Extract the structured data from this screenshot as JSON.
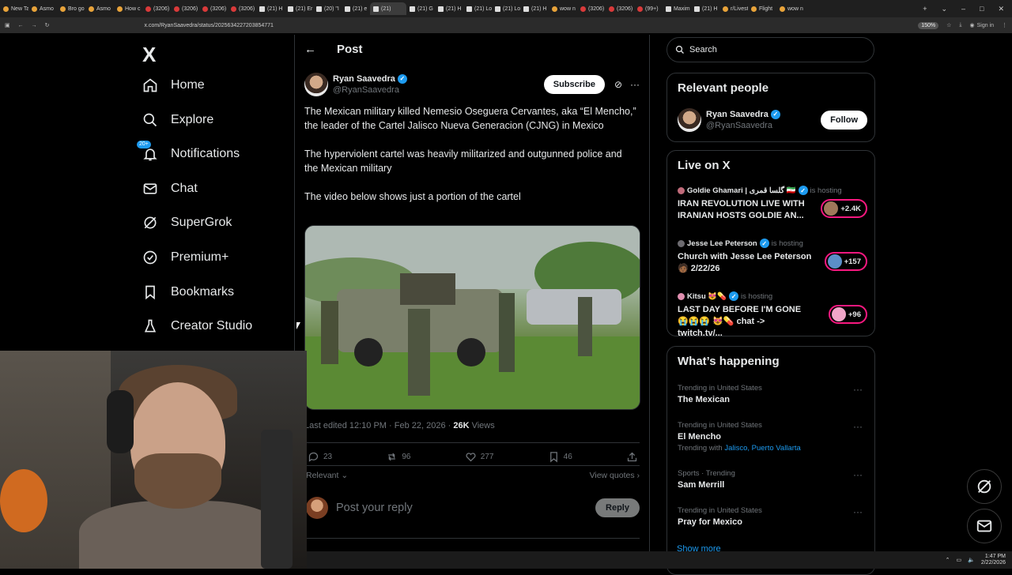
{
  "browser": {
    "tabs": [
      {
        "label": "New Ta",
        "icon": "o"
      },
      {
        "label": "Asmo",
        "icon": "o"
      },
      {
        "label": "Bro go",
        "icon": "o"
      },
      {
        "label": "Asmo",
        "icon": "o"
      },
      {
        "label": "How c",
        "icon": "o"
      },
      {
        "label": "(3206)",
        "icon": "r"
      },
      {
        "label": "(3206)",
        "icon": "r"
      },
      {
        "label": "(3206)",
        "icon": "r"
      },
      {
        "label": "(3206)",
        "icon": "r"
      },
      {
        "label": "(21) H",
        "icon": "x"
      },
      {
        "label": "(21) Er",
        "icon": "x"
      },
      {
        "label": "(20) \"I",
        "icon": "x"
      },
      {
        "label": "(21) e",
        "icon": "x"
      },
      {
        "label": "(21)",
        "icon": "x",
        "active": true
      },
      {
        "label": "(21) G",
        "icon": "x"
      },
      {
        "label": "(21) H",
        "icon": "x"
      },
      {
        "label": "(21) Lo",
        "icon": "x"
      },
      {
        "label": "(21) Lo",
        "icon": "x"
      },
      {
        "label": "(21) H",
        "icon": "x"
      },
      {
        "label": "wow n",
        "icon": "o"
      },
      {
        "label": "(3206)",
        "icon": "r"
      },
      {
        "label": "(3206)",
        "icon": "r"
      },
      {
        "label": "(99+)",
        "icon": "r"
      },
      {
        "label": "Maxim",
        "icon": "x"
      },
      {
        "label": "(21) H",
        "icon": "x"
      },
      {
        "label": "r/Livest",
        "icon": "o"
      },
      {
        "label": "Flight",
        "icon": "o"
      },
      {
        "label": "wow n",
        "icon": "o"
      }
    ],
    "url": "x.com/RyanSaavedra/status/2025634227203854771",
    "zoom": "150%",
    "signin": "Sign in"
  },
  "nav": {
    "logo": "X",
    "notif_badge": "20+",
    "items": [
      {
        "label": "Home"
      },
      {
        "label": "Explore"
      },
      {
        "label": "Notifications"
      },
      {
        "label": "Chat"
      },
      {
        "label": "SuperGrok"
      },
      {
        "label": "Premium+"
      },
      {
        "label": "Bookmarks"
      },
      {
        "label": "Creator Studio"
      }
    ]
  },
  "post": {
    "header": "Post",
    "author_name": "Ryan Saavedra",
    "author_handle": "@RyanSaavedra",
    "subscribe": "Subscribe",
    "paragraphs": [
      "The Mexican military killed Nemesio Oseguera Cervantes, aka “El Mencho,” the leader of the Cartel Jalisco Nueva Generacion (CJNG) in Mexico",
      "The hyperviolent cartel was heavily militarized and outgunned police and the Mexican military",
      "The video below shows just a portion of the cartel"
    ],
    "meta_time": "Last edited 12:10 PM · Feb 22, 2026 · ",
    "views_count": "26K",
    "views_label": " Views",
    "stats": {
      "replies": "23",
      "reposts": "96",
      "likes": "277",
      "bookmarks": "46"
    },
    "relevant": "Relevant",
    "view_quotes": "View quotes",
    "reply_placeholder": "Post your reply",
    "reply_button": "Reply"
  },
  "sidebar": {
    "search_placeholder": "Search",
    "relevant_title": "Relevant people",
    "relevant_name": "Ryan Saavedra",
    "relevant_handle": "@RyanSaavedra",
    "follow": "Follow",
    "live_title": "Live on X",
    "live": [
      {
        "host": "Goldie Ghamari | گلسا قمری 🇮🇷",
        "hosting": "is hosting",
        "title": "IRAN REVOLUTION LIVE WITH IRANIAN HOSTS GOLDIE AN...",
        "count": "+2.4K"
      },
      {
        "host": "Jesse Lee Peterson",
        "hosting": "is hosting",
        "title": "Church with Jesse Lee Peterson 🧑🏾 2/22/26",
        "count": "+157"
      },
      {
        "host": "Kitsu 😻💊",
        "hosting": "is hosting",
        "title": "LAST DAY BEFORE I'M GONE 😭😭😭 😻💊 chat -> twitch.tv/...",
        "count": "+96"
      }
    ],
    "happening_title": "What’s happening",
    "trends": [
      {
        "category": "Trending in United States",
        "name": "The Mexican",
        "sub": ""
      },
      {
        "category": "Trending in United States",
        "name": "El Mencho",
        "sub_prefix": "Trending with ",
        "sub_links": "Jalisco, Puerto Vallarta"
      },
      {
        "category": "Sports · Trending",
        "name": "Sam Merrill",
        "sub": ""
      },
      {
        "category": "Trending in United States",
        "name": "Pray for Mexico",
        "sub": ""
      }
    ],
    "show_more": "Show more"
  },
  "taskbar": {
    "time": "1:47 PM",
    "date": "2/22/2026"
  }
}
